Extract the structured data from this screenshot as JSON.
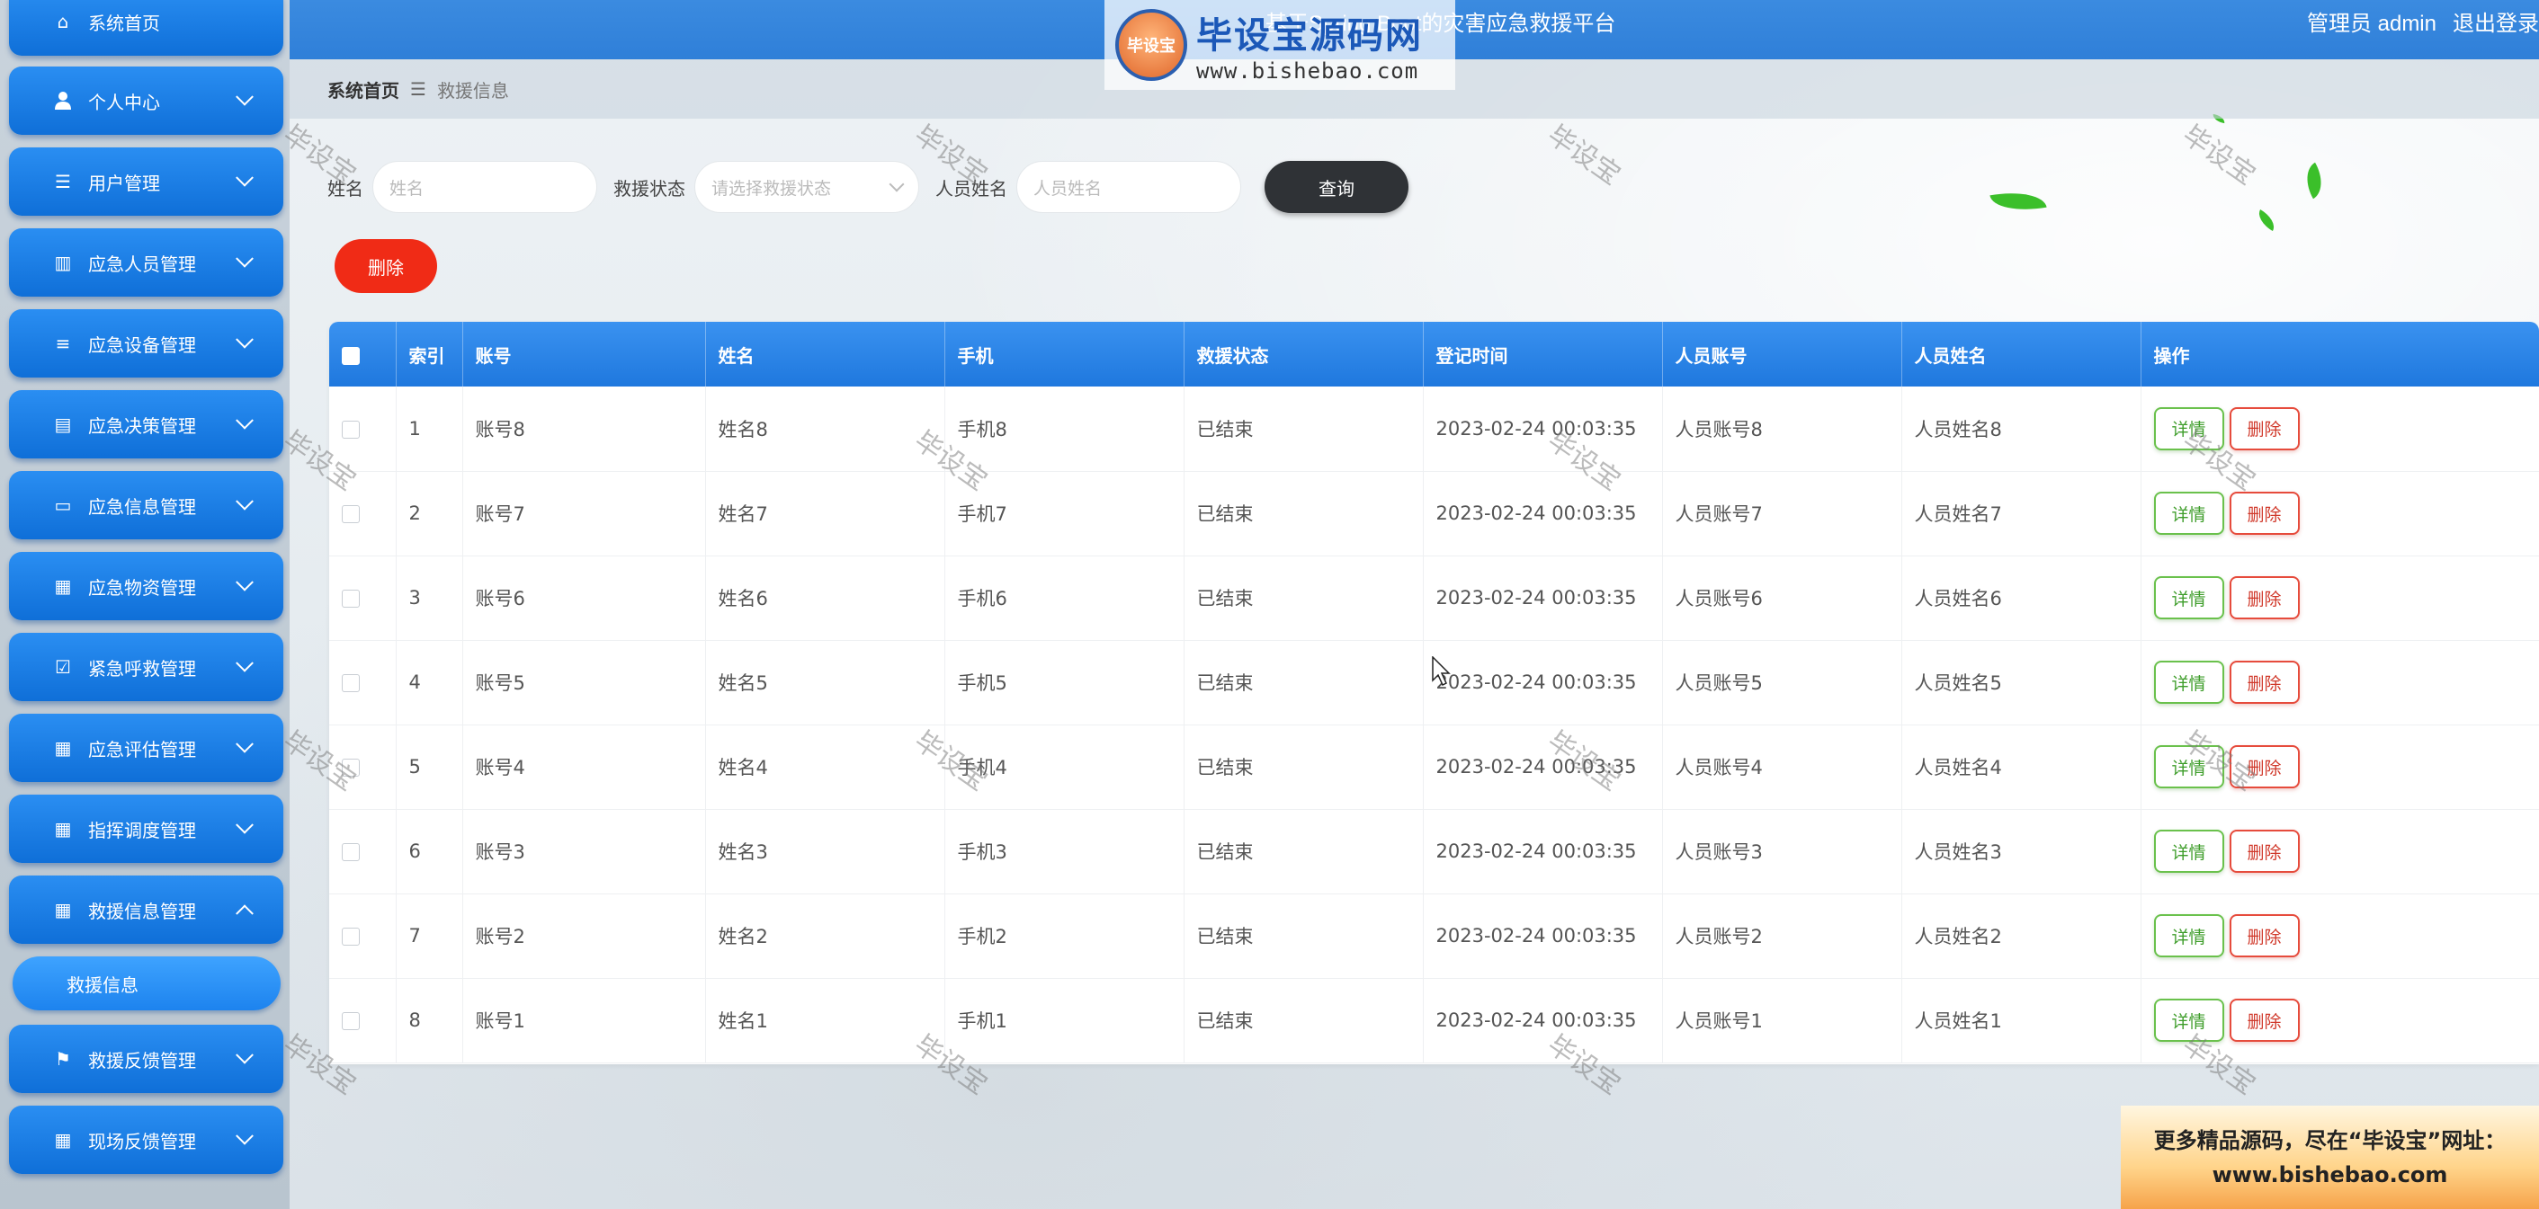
{
  "header": {
    "title": "基于Spring Boot的灾害应急救援平台",
    "user_label": "管理员 admin",
    "logout_label": "退出登录"
  },
  "logo_watermark": {
    "badge": "毕设宝",
    "main": "毕设宝源码网",
    "url": "www.bishebao.com"
  },
  "sidebar": {
    "items": [
      {
        "label": "系统首页",
        "icon": "home-icon"
      },
      {
        "label": "个人中心",
        "icon": "user-icon"
      },
      {
        "label": "用户管理",
        "icon": "list-icon"
      },
      {
        "label": "应急人员管理",
        "icon": "chart-icon"
      },
      {
        "label": "应急设备管理",
        "icon": "menu-icon"
      },
      {
        "label": "应急决策管理",
        "icon": "printer-icon"
      },
      {
        "label": "应急信息管理",
        "icon": "monitor-icon"
      },
      {
        "label": "应急物资管理",
        "icon": "clipboard-icon"
      },
      {
        "label": "紧急呼救管理",
        "icon": "clipboard-check-icon"
      },
      {
        "label": "应急评估管理",
        "icon": "grid-icon"
      },
      {
        "label": "指挥调度管理",
        "icon": "grid-icon"
      },
      {
        "label": "救援信息管理",
        "icon": "grid-icon"
      },
      {
        "label": "救援反馈管理",
        "icon": "flag-icon"
      },
      {
        "label": "现场反馈管理",
        "icon": "grid-icon"
      }
    ],
    "active_sub": "救援信息"
  },
  "breadcrumb": {
    "home": "系统首页",
    "separator": "☰",
    "current": "救援信息"
  },
  "search": {
    "name_label": "姓名",
    "name_placeholder": "姓名",
    "status_label": "救援状态",
    "status_placeholder": "请选择救援状态",
    "staff_label": "人员姓名",
    "staff_placeholder": "人员姓名",
    "query_button": "查询"
  },
  "batch_delete_button": "删除",
  "table": {
    "headers": [
      "索引",
      "账号",
      "姓名",
      "手机",
      "救援状态",
      "登记时间",
      "人员账号",
      "人员姓名",
      "操作"
    ],
    "detail_label": "详情",
    "delete_label": "删除",
    "rows": [
      {
        "index": "1",
        "account": "账号8",
        "name": "姓名8",
        "phone": "手机8",
        "status": "已结束",
        "time": "2023-02-24 00:03:35",
        "staff_account": "人员账号8",
        "staff_name": "人员姓名8"
      },
      {
        "index": "2",
        "account": "账号7",
        "name": "姓名7",
        "phone": "手机7",
        "status": "已结束",
        "time": "2023-02-24 00:03:35",
        "staff_account": "人员账号7",
        "staff_name": "人员姓名7"
      },
      {
        "index": "3",
        "account": "账号6",
        "name": "姓名6",
        "phone": "手机6",
        "status": "已结束",
        "time": "2023-02-24 00:03:35",
        "staff_account": "人员账号6",
        "staff_name": "人员姓名6"
      },
      {
        "index": "4",
        "account": "账号5",
        "name": "姓名5",
        "phone": "手机5",
        "status": "已结束",
        "time": "2023-02-24 00:03:35",
        "staff_account": "人员账号5",
        "staff_name": "人员姓名5"
      },
      {
        "index": "5",
        "account": "账号4",
        "name": "姓名4",
        "phone": "手机4",
        "status": "已结束",
        "time": "2023-02-24 00:03:35",
        "staff_account": "人员账号4",
        "staff_name": "人员姓名4"
      },
      {
        "index": "6",
        "account": "账号3",
        "name": "姓名3",
        "phone": "手机3",
        "status": "已结束",
        "time": "2023-02-24 00:03:35",
        "staff_account": "人员账号3",
        "staff_name": "人员姓名3"
      },
      {
        "index": "7",
        "account": "账号2",
        "name": "姓名2",
        "phone": "手机2",
        "status": "已结束",
        "time": "2023-02-24 00:03:35",
        "staff_account": "人员账号2",
        "staff_name": "人员姓名2"
      },
      {
        "index": "8",
        "account": "账号1",
        "name": "姓名1",
        "phone": "手机1",
        "status": "已结束",
        "time": "2023-02-24 00:03:35",
        "staff_account": "人员账号1",
        "staff_name": "人员姓名1"
      }
    ]
  },
  "watermark_text": "毕设宝",
  "ad": {
    "line1": "更多精品源码，尽在“毕设宝”网址：",
    "line2": "www.bishebao.com"
  },
  "colors": {
    "sidebar_button": "#1a7ee6",
    "header": "#3385dc",
    "query_button": "#2f3236",
    "danger": "#f02b16",
    "detail_green": "#6ac14c"
  }
}
